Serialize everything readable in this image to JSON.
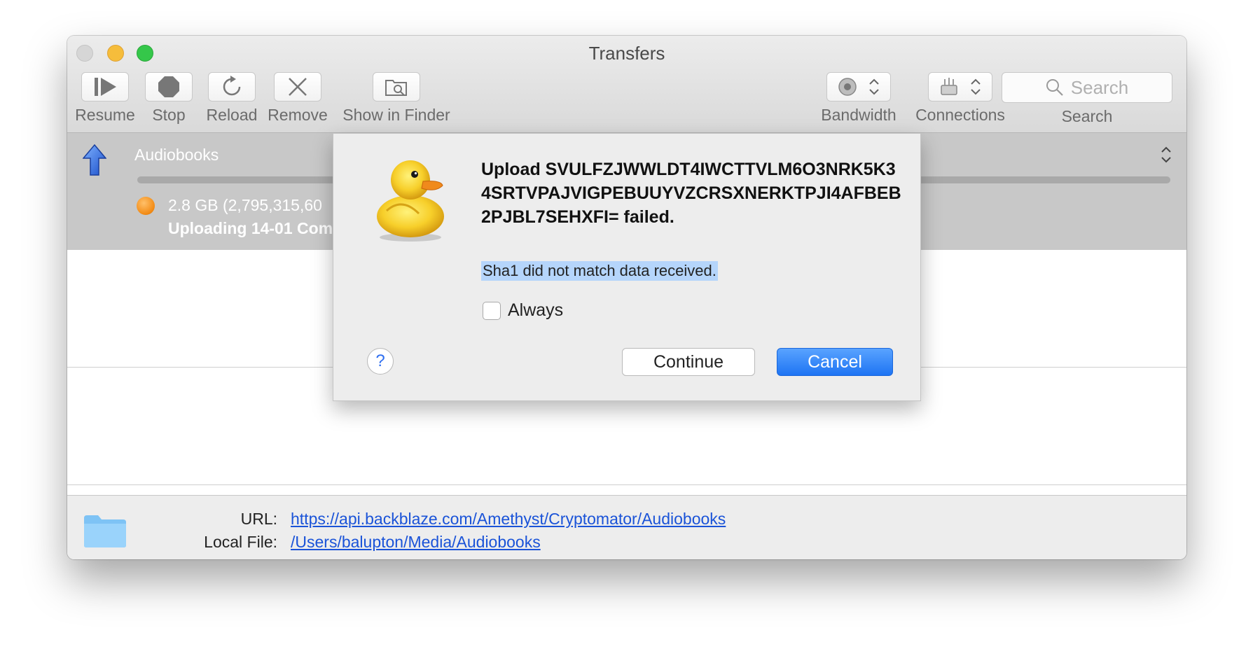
{
  "window": {
    "title": "Transfers"
  },
  "toolbar": {
    "resume": "Resume",
    "stop": "Stop",
    "reload": "Reload",
    "remove": "Remove",
    "show_in_finder": "Show in Finder",
    "bandwidth": "Bandwidth",
    "connections": "Connections",
    "search_placeholder": "Search",
    "search_label": "Search"
  },
  "transfer": {
    "name": "Audiobooks",
    "size": "2.8 GB (2,795,315,60",
    "status": "Uploading 14-01 Com",
    "progress_percent": 0,
    "status_color": "#f28a13"
  },
  "footer": {
    "url_label": "URL:",
    "url_value": "https://api.backblaze.com/Amethyst/Cryptomator/Audiobooks",
    "local_label": "Local File:",
    "local_value": "/Users/balupton/Media/Audiobooks"
  },
  "dialog": {
    "title": "Upload SVULFZJWWLDT4IWCTTVLM6O3NRK5K34SRTVPAJVIGPEBUUYVZCRSXNERKTPJI4AFBEB2PJBL7SEHXFI= failed.",
    "message": "Sha1 did not match data received.",
    "checkbox_label": "Always",
    "help": "?",
    "continue": "Continue",
    "cancel": "Cancel",
    "accent_color": "#1e74f3"
  }
}
